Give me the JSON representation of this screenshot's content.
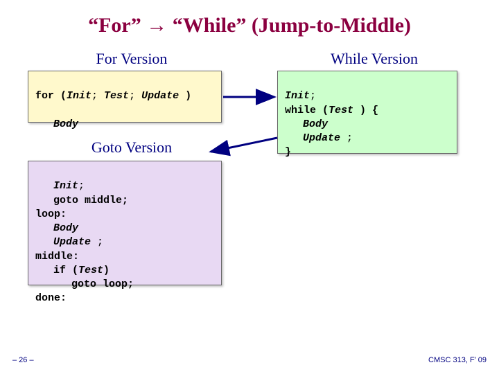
{
  "title": "“For” → “While” (Jump-to-Middle)",
  "sections": {
    "for": {
      "heading": "For Version"
    },
    "while": {
      "heading": "While Version"
    },
    "goto": {
      "heading": "Goto Version"
    }
  },
  "code": {
    "for": {
      "kw_for": "for (",
      "init": "Init",
      "sep1": "; ",
      "test": "Test",
      "sep2": "; ",
      "update": "Update",
      "close": " )",
      "body": "Body"
    },
    "while": {
      "init": "Init",
      "semi1": ";",
      "kw_while": "while (",
      "test": "Test",
      "close_brace_open": " ) {",
      "body": "Body",
      "update": "Update",
      "update_semi": " ;",
      "brace_close": "}"
    },
    "goto": {
      "init": "Init",
      "semi1": ";",
      "goto_middle": "goto middle;",
      "loop_label": "loop:",
      "body": "Body",
      "update": "Update",
      "update_semi": " ;",
      "middle_label": "middle:",
      "if_open": "if (",
      "test": "Test",
      "if_close": ")",
      "goto_loop": "goto loop;",
      "done_label": "done:"
    }
  },
  "footer": {
    "left": "– 26 –",
    "right": "CMSC 313, F’ 09"
  }
}
